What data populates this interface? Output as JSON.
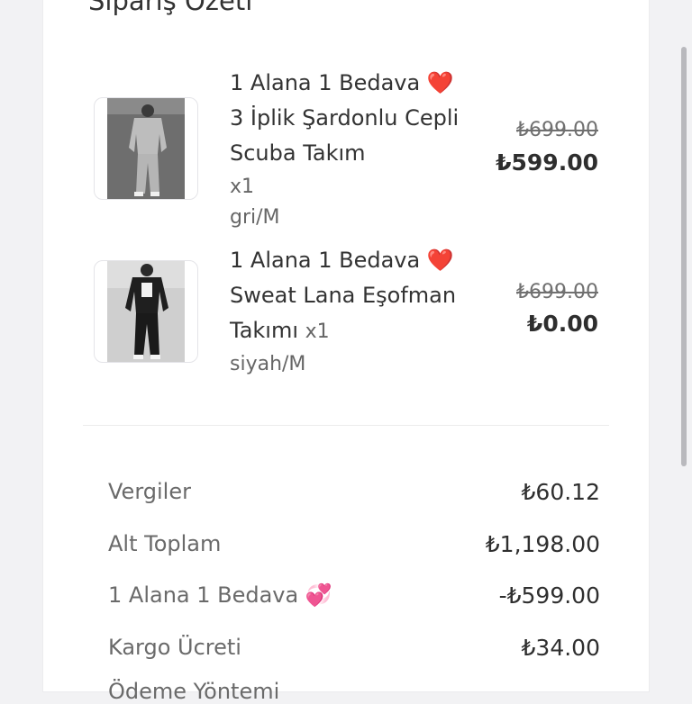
{
  "section_title": "Sipariş Özeti",
  "items": [
    {
      "name_line1": "1 Alana 1 Bedava",
      "heart": "❤️",
      "name_rest": "3 İplik Şardonlu Cepli Scuba Takım",
      "qty": "x1",
      "variant": "gri/M",
      "old_price": "₺699.00",
      "price": "₺599.00"
    },
    {
      "name_line1": "1 Alana 1 Bedava",
      "heart": "❤️",
      "name_rest": "Sweat Lana Eşofman Takımı",
      "qty": "x1",
      "variant": "siyah/M",
      "old_price": "₺699.00",
      "price": "₺0.00"
    }
  ],
  "summary": {
    "taxes_label": "Vergiler",
    "taxes_value": "₺60.12",
    "subtotal_label": "Alt Toplam",
    "subtotal_value": "₺1,198.00",
    "promo_label": "1 Alana 1 Bedava 💞",
    "promo_value": "-₺599.00",
    "shipping_label": "Kargo Ücreti",
    "shipping_value": "₺34.00",
    "cut_off_text": "Ödeme Yöntemi"
  },
  "colors": {
    "heart": "#e0162b",
    "panel": "#ffffff",
    "page": "#f2f2f4"
  }
}
